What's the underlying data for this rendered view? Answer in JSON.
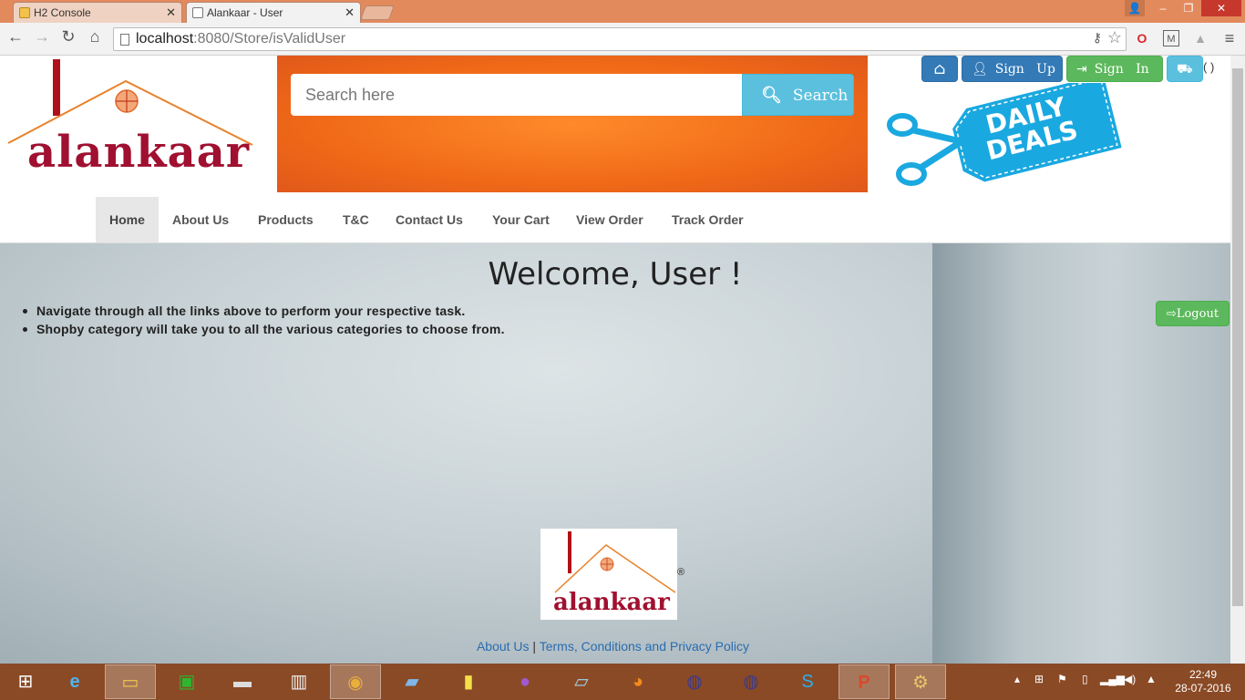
{
  "browser": {
    "tabs": [
      {
        "title": "H2 Console",
        "active": false
      },
      {
        "title": "Alankaar - User",
        "active": true
      }
    ],
    "url_host": "localhost",
    "url_path": ":8080/Store/isValidUser",
    "window_controls": {
      "minimize": "–",
      "restore": "❐",
      "close": "✕"
    },
    "nav": {
      "back": "←",
      "forward": "→",
      "reload": "↻",
      "home": "⌂"
    }
  },
  "header": {
    "logo_text": "alankaar",
    "search_placeholder": "Search here",
    "search_button": "Search",
    "buttons": {
      "home_icon": "⌂",
      "signup": "Sign   Up",
      "signin": "Sign   In",
      "cart_icon": "🛒",
      "cart_count": "( )"
    },
    "deals_text_1": "DAILY",
    "deals_text_2": "DEALS"
  },
  "navbar": {
    "items": [
      {
        "label": "Home",
        "active": true
      },
      {
        "label": "About Us"
      },
      {
        "label": "Products"
      },
      {
        "label": "T&C"
      },
      {
        "label": "Contact Us"
      },
      {
        "label": "Your Cart"
      },
      {
        "label": "View Order"
      },
      {
        "label": "Track Order"
      }
    ]
  },
  "main": {
    "welcome": "Welcome, User !",
    "tips": [
      "Navigate through all the links above to perform your respective task.",
      "Shopby category will take you to all the various categories to choose from."
    ],
    "logout": "Logout"
  },
  "footer": {
    "registered": "®",
    "logo_text": "alankaar",
    "link_about": "About Us",
    "separator": " | ",
    "link_terms": "Terms, Conditions and Privacy Policy"
  },
  "taskbar": {
    "time": "22:49",
    "date": "28-07-2016"
  },
  "colors": {
    "brand": "#a01030",
    "orange_banner": "#f06a18",
    "primary": "#337ab7",
    "success": "#5cb85c",
    "info": "#5bc0de"
  }
}
